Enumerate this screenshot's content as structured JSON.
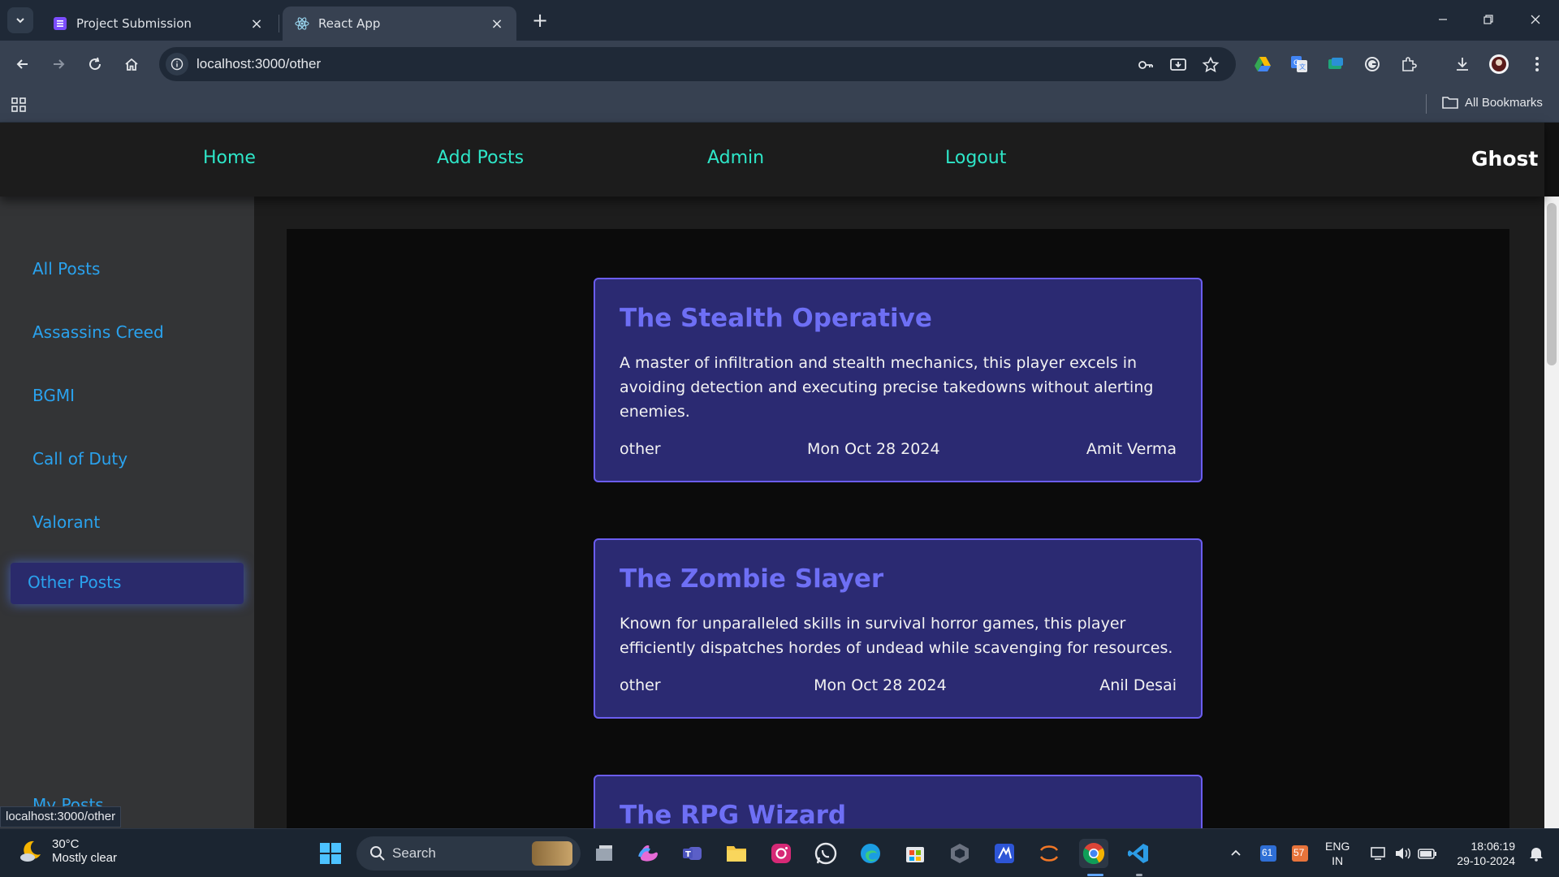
{
  "browser": {
    "tabs": [
      {
        "title": "Project Submission",
        "favicon": "forms-icon"
      },
      {
        "title": "React App",
        "favicon": "react-icon",
        "active": true
      }
    ],
    "url": "localhost:3000/other",
    "all_bookmarks": "All Bookmarks",
    "status_url": "localhost:3000/other"
  },
  "app": {
    "nav": {
      "home": "Home",
      "add_posts": "Add Posts",
      "admin": "Admin",
      "logout": "Logout",
      "brand": "Ghost"
    },
    "sidebar": {
      "items": [
        {
          "label": "All Posts"
        },
        {
          "label": "Assassins Creed"
        },
        {
          "label": "BGMI"
        },
        {
          "label": "Call of Duty"
        },
        {
          "label": "Valorant"
        },
        {
          "label": "Other Posts",
          "active": true
        },
        {
          "label": "My Posts"
        }
      ]
    },
    "posts": [
      {
        "title": "The Stealth Operative",
        "description": "A master of infiltration and stealth mechanics, this player excels in avoiding detection and executing precise takedowns without alerting enemies.",
        "category": "other",
        "date": "Mon Oct 28 2024",
        "author": "Amit Verma"
      },
      {
        "title": "The Zombie Slayer",
        "description": "Known for unparalleled skills in survival horror games, this player efficiently dispatches hordes of undead while scavenging for resources.",
        "category": "other",
        "date": "Mon Oct 28 2024",
        "author": "Anil Desai"
      },
      {
        "title": "The RPG Wizard"
      }
    ]
  },
  "taskbar": {
    "weather": {
      "temp": "30°C",
      "condition": "Mostly clear"
    },
    "search_placeholder": "Search",
    "tray": {
      "badge_1": "61",
      "badge_2": "57",
      "lang_1": "ENG",
      "lang_2": "IN",
      "time": "18:06:19",
      "date": "29-10-2024"
    }
  },
  "colors": {
    "nav_link": "#2ee6c8",
    "sidebar_link": "#2aa2ee",
    "card_bg": "#2b2a72",
    "card_border": "#6b5df0",
    "card_title": "#6e6ff5"
  }
}
